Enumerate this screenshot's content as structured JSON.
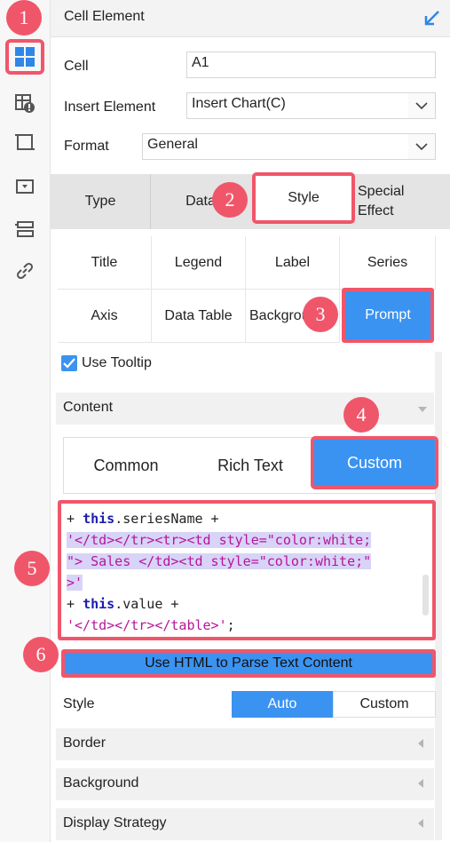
{
  "markers": [
    "1",
    "2",
    "3",
    "4",
    "5",
    "6"
  ],
  "sidebar": {
    "items": [
      {
        "icon": "cell-element-icon",
        "active": true
      },
      {
        "icon": "cell-attribute-icon"
      },
      {
        "icon": "float-element-icon"
      },
      {
        "icon": "widget-icon"
      },
      {
        "icon": "form-icon"
      },
      {
        "icon": "hyperlink-icon"
      }
    ]
  },
  "header": {
    "title": "Cell Element"
  },
  "cell": {
    "label": "Cell",
    "value": "A1"
  },
  "insert_element": {
    "label": "Insert Element",
    "value": "Insert Chart(C)"
  },
  "format": {
    "label": "Format",
    "value": "General"
  },
  "main_tabs": [
    {
      "label": "Type"
    },
    {
      "label": "Data"
    },
    {
      "label": "Style",
      "selected": true
    },
    {
      "label": "Special Effect"
    }
  ],
  "style_tabs": {
    "row1": [
      "Title",
      "Legend",
      "Label",
      "Series"
    ],
    "row2": [
      "Axis",
      "Data Table",
      "Background",
      "Prompt"
    ],
    "selected": "Prompt"
  },
  "tooltip": {
    "label": "Use Tooltip",
    "checked": true
  },
  "content": {
    "label": "Content"
  },
  "content_tabs": [
    {
      "label": "Common"
    },
    {
      "label": "Rich Text"
    },
    {
      "label": "Custom",
      "selected": true
    }
  ],
  "code": {
    "line1_plus": "+ ",
    "line1_kw": "this",
    "line1_rest": ".seriesName +",
    "line2": "'</td></tr><tr><td style=\"color:white;",
    "line3": "\"> Sales </td><td style=\"color:white;\"",
    "line4": ">'",
    "line5_plus": "+ ",
    "line5_kw": "this",
    "line5_rest": ".value +",
    "line6_str": "'</td></tr></table>'",
    "line6_end": ";"
  },
  "parse_button": {
    "label": "Use HTML to Parse Text Content"
  },
  "style_row": {
    "label": "Style",
    "options": [
      "Auto",
      "Custom"
    ],
    "selected": "Auto"
  },
  "sections": [
    {
      "label": "Border"
    },
    {
      "label": "Background"
    },
    {
      "label": "Display Strategy"
    }
  ],
  "colors": {
    "accent": "#3b93f1",
    "highlight_border": "#f0566a"
  }
}
